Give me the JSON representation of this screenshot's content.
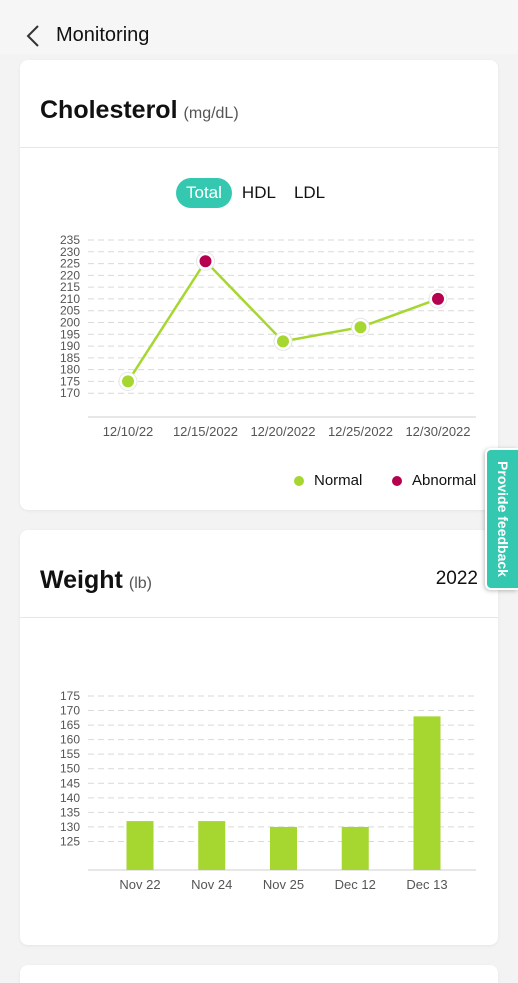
{
  "header": {
    "title": "Monitoring"
  },
  "cholesterol": {
    "title": "Cholesterol",
    "unit": "(mg/dL)",
    "tabs": [
      "Total",
      "HDL",
      "LDL"
    ],
    "active_tab": "Total",
    "legend": {
      "normal": "Normal",
      "abnormal": "Abnormal"
    },
    "colors": {
      "normal": "#a6d630",
      "abnormal": "#b5004f",
      "line": "#a6d630",
      "tab_active": "#35c8b0"
    }
  },
  "weight": {
    "title": "Weight",
    "unit": "(lb)",
    "year": "2022",
    "colors": {
      "bar": "#a6d630"
    }
  },
  "feedback": {
    "label": "Provide feedback"
  },
  "chart_data": [
    {
      "type": "line",
      "x": [
        "12/10/22",
        "12/15/2022",
        "12/20/2022",
        "12/25/2022",
        "12/30/2022"
      ],
      "series": [
        {
          "name": "Total",
          "values": [
            175,
            226,
            192,
            198,
            210
          ],
          "status": [
            "Normal",
            "Abnormal",
            "Normal",
            "Normal",
            "Abnormal"
          ]
        }
      ],
      "yticks": [
        170,
        175,
        180,
        185,
        190,
        195,
        200,
        205,
        210,
        215,
        220,
        225,
        230,
        235
      ],
      "ylim": [
        165,
        235
      ],
      "grid": true,
      "legend": [
        "Normal",
        "Abnormal"
      ],
      "legend_position": "bottom-right"
    },
    {
      "type": "bar",
      "categories": [
        "Nov 22",
        "Nov 24",
        "Nov 25",
        "Dec 12",
        "Dec 13"
      ],
      "values": [
        132,
        132,
        130,
        130,
        168
      ],
      "yticks": [
        125,
        130,
        135,
        140,
        145,
        150,
        155,
        160,
        165,
        170,
        175
      ],
      "ylim": [
        120,
        175
      ],
      "grid": true
    }
  ]
}
